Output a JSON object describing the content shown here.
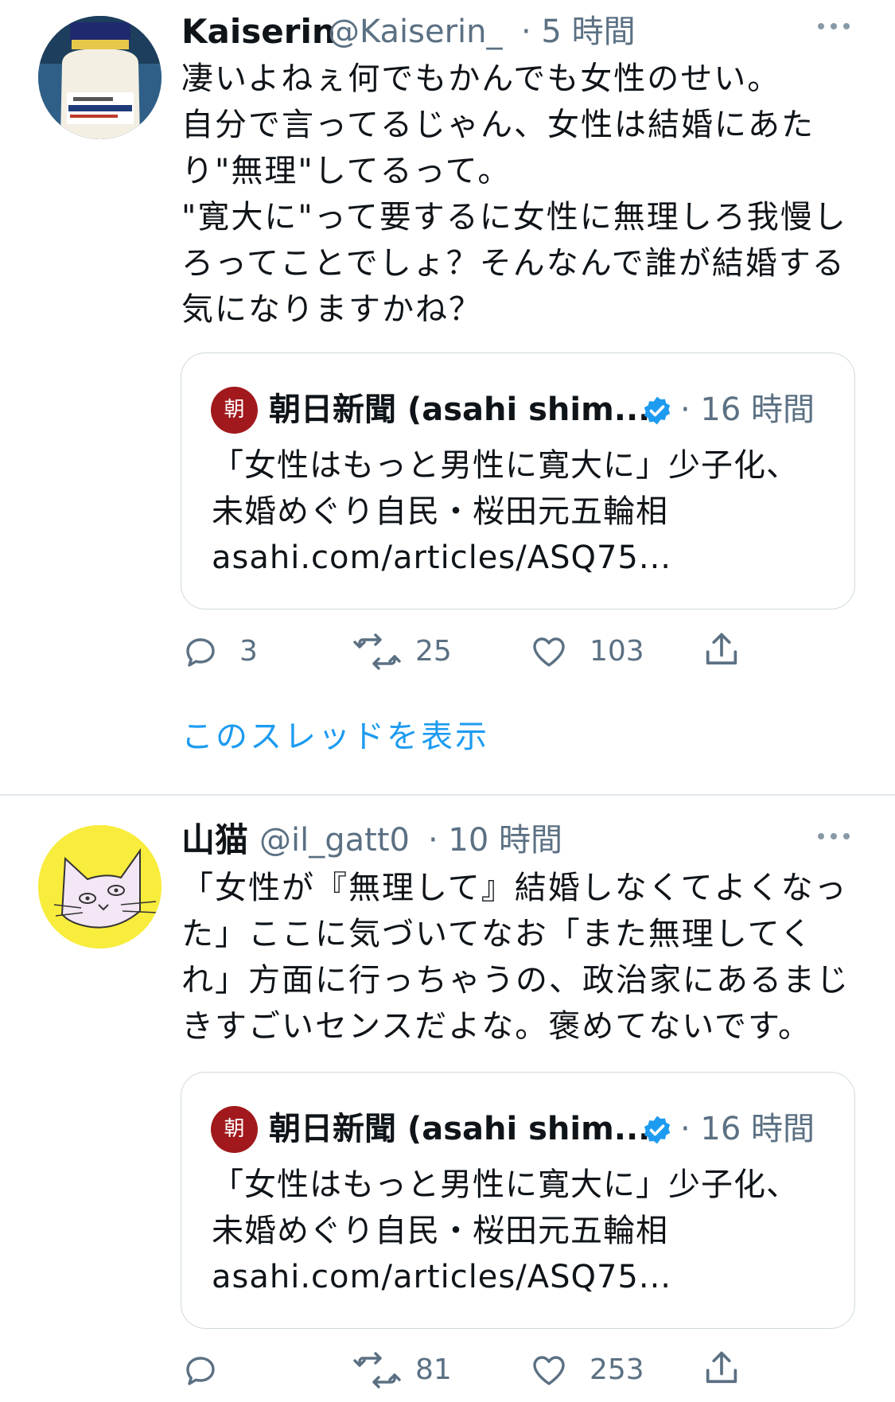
{
  "tweets": [
    {
      "author_name": "Kaiserin",
      "handle": "@Kaiserin_",
      "time": "· 5 時間",
      "text_lines": [
        "凄いよねぇ何でもかんでも女性のせい。",
        "自分で言ってるじゃん、女性は結婚にあた",
        "り\"無理\"してるって。",
        "\"寛大に\"って要するに女性に無理しろ我慢し",
        "ろってことでしょ？そんなんで誰が結婚する",
        "気になりますかね？"
      ],
      "quote": {
        "logo_text": "朝",
        "name": "朝日新聞 (asahi shim...",
        "time": "· 16 時間",
        "text_lines": [
          "「女性はもっと男性に寛大に」少子化、",
          "未婚めぐり自民・桜田元五輪相",
          "asahi.com/articles/ASQ75..."
        ]
      },
      "actions": {
        "reply": "3",
        "retweet": "25",
        "like": "103"
      },
      "thread_link": "このスレッドを表示"
    },
    {
      "author_name": "山猫",
      "handle": "@il_gatt0",
      "time": "· 10 時間",
      "text_lines": [
        "「女性が『無理して』結婚しなくてよくなっ",
        "た」ここに気づいてなお「また無理してく",
        "れ」方面に行っちゃうの、政治家にあるまじ",
        "きすごいセンスだよな。褒めてないです。"
      ],
      "quote": {
        "logo_text": "朝",
        "name": "朝日新聞 (asahi shim...",
        "time": "· 16 時間",
        "text_lines": [
          "「女性はもっと男性に寛大に」少子化、",
          "未婚めぐり自民・桜田元五輪相",
          "asahi.com/articles/ASQ75..."
        ]
      },
      "actions": {
        "reply": "",
        "retweet": "81",
        "like": "253"
      }
    }
  ],
  "colors": {
    "link": "#1d9bf0",
    "secondary_text": "#5b7083",
    "verified": "#1d9bf0",
    "asahi_red": "#a1191c"
  },
  "icons": [
    "more-icon",
    "verified-icon",
    "reply-icon",
    "retweet-icon",
    "like-icon",
    "share-icon"
  ]
}
